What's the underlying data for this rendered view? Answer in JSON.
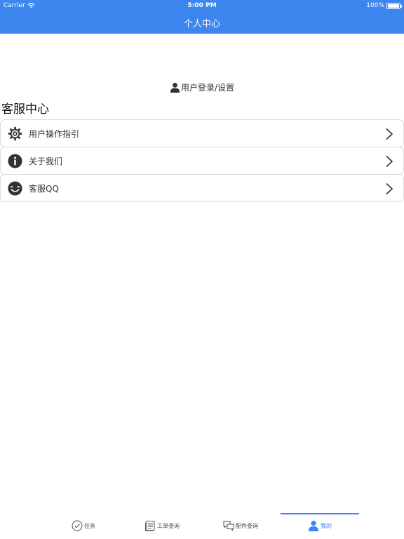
{
  "status_bar": {
    "carrier": "Carrier",
    "time": "5:00 PM",
    "battery": "100%"
  },
  "nav": {
    "title": "个人中心"
  },
  "login": {
    "label": "用户登录/设置",
    "icon": "user-icon"
  },
  "section": {
    "title": "客服中心"
  },
  "menu": {
    "items": [
      {
        "label": "用户操作指引",
        "icon": "gear-icon"
      },
      {
        "label": "关于我们",
        "icon": "info-icon"
      },
      {
        "label": "客服QQ",
        "icon": "smile-icon"
      }
    ]
  },
  "tabs": [
    {
      "label": "任务",
      "icon": "check-circle-icon",
      "active": false
    },
    {
      "label": "工单查询",
      "icon": "document-icon",
      "active": false
    },
    {
      "label": "配件查询",
      "icon": "chat-icon",
      "active": false
    },
    {
      "label": "我的",
      "icon": "user-icon",
      "active": true
    }
  ],
  "colors": {
    "accent": "#3d86f0",
    "icon_dark": "#333333",
    "border": "#dcdcdc"
  }
}
